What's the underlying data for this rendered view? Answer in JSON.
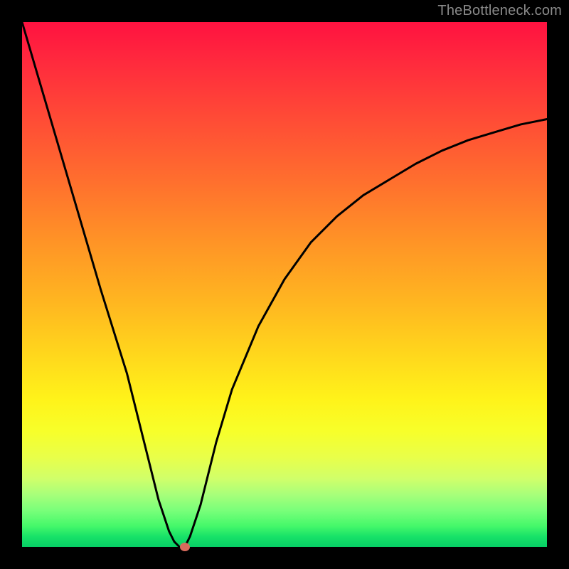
{
  "watermark": "TheBottleneck.com",
  "colors": {
    "frame": "#000000",
    "gradient_top": "#ff1240",
    "gradient_bottom": "#06cf65",
    "curve": "#000000",
    "marker": "#d86b5c"
  },
  "chart_data": {
    "type": "line",
    "title": "",
    "xlabel": "",
    "ylabel": "",
    "xlim": [
      0,
      100
    ],
    "ylim": [
      0,
      100
    ],
    "grid": false,
    "legend": false,
    "series": [
      {
        "name": "bottleneck-curve",
        "x": [
          0,
          5,
          10,
          15,
          20,
          24,
          26,
          28,
          29,
          30,
          31,
          32,
          34,
          37,
          40,
          45,
          50,
          55,
          60,
          65,
          70,
          75,
          80,
          85,
          90,
          95,
          100
        ],
        "values": [
          100,
          83,
          66,
          49,
          33,
          17,
          9,
          3,
          1,
          0,
          0,
          2,
          8,
          20,
          30,
          42,
          51,
          58,
          63,
          67,
          70,
          73,
          75.5,
          77.5,
          79,
          80.5,
          81.5
        ]
      }
    ],
    "annotations": [
      {
        "name": "optimal-marker",
        "x": 31,
        "y": 0
      }
    ]
  }
}
